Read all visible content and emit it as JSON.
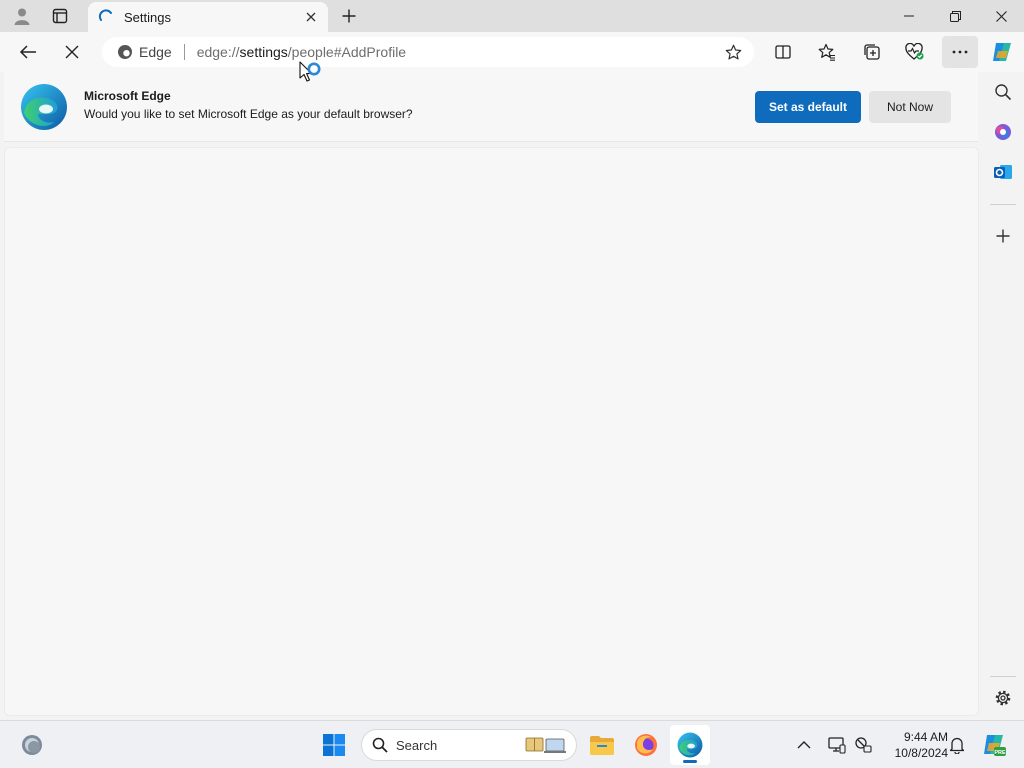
{
  "tab": {
    "title": "Settings"
  },
  "omnibox": {
    "identity_label": "Edge",
    "url_prefix": "edge://",
    "url_host": "settings",
    "url_path": "/people#AddProfile"
  },
  "infobar": {
    "title": "Microsoft Edge",
    "message": "Would you like to set Microsoft Edge as your default browser?",
    "primary_button": "Set as default",
    "secondary_button": "Not Now"
  },
  "taskbar": {
    "search_label": "Search",
    "time": "9:44 AM",
    "date": "10/8/2024"
  },
  "colors": {
    "accent": "#0f6cbd",
    "titlebar": "#dfdfdf",
    "surface": "#f7f7f7"
  },
  "icons": {
    "titlebar": [
      "profile-icon",
      "tab-actions-icon",
      "loading-spinner-icon",
      "close-icon",
      "plus-icon",
      "minimize-icon",
      "restore-icon",
      "close-window-icon"
    ],
    "toolbar": [
      "back-arrow-icon",
      "stop-loading-icon",
      "edge-logo-icon",
      "star-icon",
      "split-screen-icon",
      "favorites-icon",
      "collections-icon",
      "browser-essentials-icon",
      "more-icon",
      "copilot-icon"
    ],
    "sidebar": [
      "search-icon",
      "office-icon",
      "outlook-icon",
      "plus-icon",
      "gear-icon"
    ],
    "taskbar": [
      "widgets-icon",
      "windows-start-icon",
      "search-icon",
      "file-explorer-icon",
      "firefox-icon",
      "edge-icon",
      "chevron-up-icon",
      "display-icon",
      "network-icon",
      "bell-icon",
      "copilot-icon"
    ]
  }
}
